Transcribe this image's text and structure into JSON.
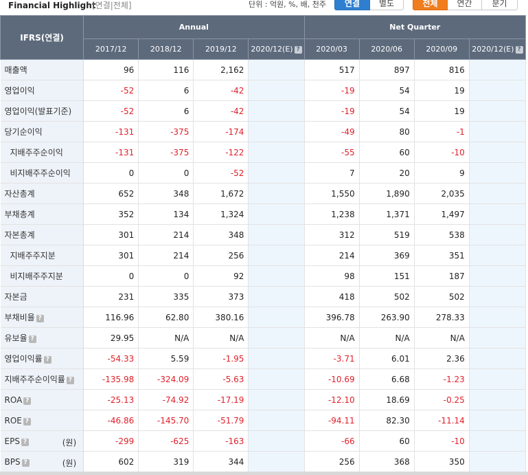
{
  "header": {
    "title": "Financial Highlight",
    "subtitle": "[연결|전체]",
    "unit_text": "단위 : 억원, %, 배, 천주"
  },
  "toggles": {
    "scope": [
      "연결",
      "별도"
    ],
    "period": [
      "전체",
      "연간",
      "분기"
    ]
  },
  "table": {
    "corner_label": "IFRS(연결)",
    "group_annual": "Annual",
    "group_quarter": "Net Quarter",
    "periods": [
      "2017/12",
      "2018/12",
      "2019/12",
      "2020/12(E)",
      "2020/03",
      "2020/06",
      "2020/09",
      "2020/12(E)"
    ],
    "rows": [
      {
        "label": "매출액",
        "values": [
          "96",
          "116",
          "2,162",
          "",
          "517",
          "897",
          "816",
          ""
        ]
      },
      {
        "label": "영업이익",
        "values": [
          "-52",
          "6",
          "-42",
          "",
          "-19",
          "54",
          "19",
          ""
        ]
      },
      {
        "label": "영업이익(발표기준)",
        "values": [
          "-52",
          "6",
          "-42",
          "",
          "-19",
          "54",
          "19",
          ""
        ]
      },
      {
        "label": "당기순이익",
        "values": [
          "-131",
          "-375",
          "-174",
          "",
          "-49",
          "80",
          "-1",
          ""
        ]
      },
      {
        "label": "지배주주순이익",
        "values": [
          "-131",
          "-375",
          "-122",
          "",
          "-55",
          "60",
          "-10",
          ""
        ]
      },
      {
        "label": "비지배주주순이익",
        "values": [
          "0",
          "0",
          "-52",
          "",
          "7",
          "20",
          "9",
          ""
        ]
      },
      {
        "label": "자산총계",
        "values": [
          "652",
          "348",
          "1,672",
          "",
          "1,550",
          "1,890",
          "2,035",
          ""
        ]
      },
      {
        "label": "부채총계",
        "values": [
          "352",
          "134",
          "1,324",
          "",
          "1,238",
          "1,371",
          "1,497",
          ""
        ]
      },
      {
        "label": "자본총계",
        "values": [
          "301",
          "214",
          "348",
          "",
          "312",
          "519",
          "538",
          ""
        ]
      },
      {
        "label": "지배주주지분",
        "values": [
          "301",
          "214",
          "256",
          "",
          "214",
          "369",
          "351",
          ""
        ]
      },
      {
        "label": "비지배주주지분",
        "values": [
          "0",
          "0",
          "92",
          "",
          "98",
          "151",
          "187",
          ""
        ]
      },
      {
        "label": "자본금",
        "values": [
          "231",
          "335",
          "373",
          "",
          "418",
          "502",
          "502",
          ""
        ]
      },
      {
        "label": "부채비율",
        "values": [
          "116.96",
          "62.80",
          "380.16",
          "",
          "396.78",
          "263.90",
          "278.33",
          ""
        ]
      },
      {
        "label": "유보율",
        "values": [
          "29.95",
          "N/A",
          "N/A",
          "",
          "N/A",
          "N/A",
          "N/A",
          ""
        ]
      },
      {
        "label": "영업이익률",
        "values": [
          "-54.33",
          "5.59",
          "-1.95",
          "",
          "-3.71",
          "6.01",
          "2.36",
          ""
        ]
      },
      {
        "label": "지배주주순이익률",
        "values": [
          "-135.98",
          "-324.09",
          "-5.63",
          "",
          "-10.69",
          "6.68",
          "-1.23",
          ""
        ]
      },
      {
        "label": "ROA",
        "values": [
          "-25.13",
          "-74.92",
          "-17.19",
          "",
          "-12.10",
          "18.69",
          "-0.25",
          ""
        ]
      },
      {
        "label": "ROE",
        "values": [
          "-46.86",
          "-145.70",
          "-51.79",
          "",
          "-94.11",
          "82.30",
          "-11.14",
          ""
        ]
      },
      {
        "label": "EPS",
        "unit": "(원)",
        "values": [
          "-299",
          "-625",
          "-163",
          "",
          "-66",
          "60",
          "-10",
          ""
        ]
      },
      {
        "label": "BPS",
        "unit": "(원)",
        "values": [
          "602",
          "319",
          "344",
          "",
          "256",
          "368",
          "350",
          ""
        ]
      }
    ]
  },
  "colors": {
    "header_bg": "#5d6a7c",
    "row_label_bg": "#eef3f9",
    "estimate_bg": "#eef6fd",
    "negative": "#e0202a",
    "btn_blue": "#2f7fd1",
    "btn_orange": "#f07d1e"
  }
}
